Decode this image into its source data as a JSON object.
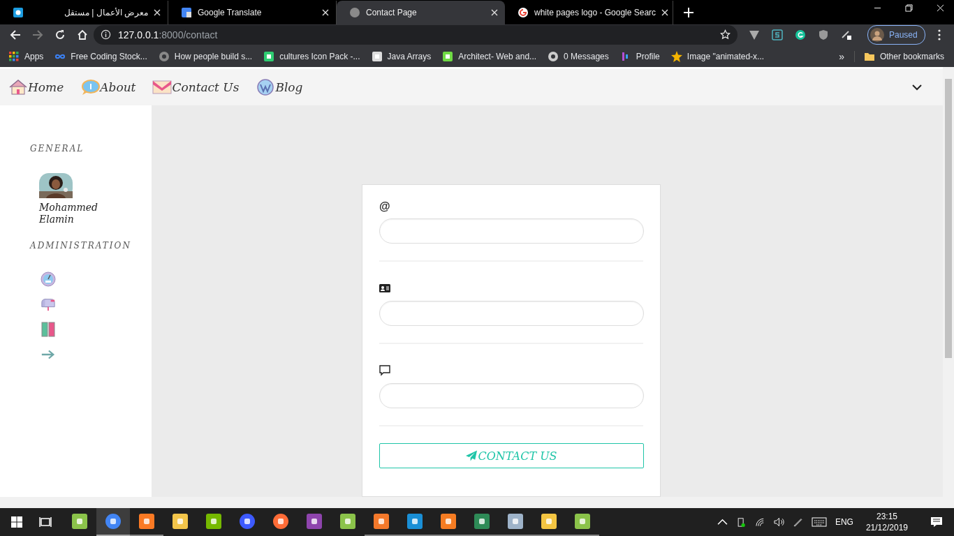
{
  "browser": {
    "tabs": [
      {
        "title": "معرض الأعمال | مستقل",
        "selected": false
      },
      {
        "title": "Google Translate",
        "selected": false
      },
      {
        "title": "Contact Page",
        "selected": true
      },
      {
        "title": "white pages logo - Google Searc",
        "selected": false
      }
    ],
    "address": {
      "host": "127.0.0.1",
      "path": ":8000/contact"
    },
    "profile": {
      "label": "Paused"
    },
    "bookmarks": [
      {
        "label": "Apps"
      },
      {
        "label": "Free Coding Stock..."
      },
      {
        "label": "How people build s..."
      },
      {
        "label": "cultures Icon Pack -..."
      },
      {
        "label": "Java Arrays"
      },
      {
        "label": "Architect- Web and..."
      },
      {
        "label": "0 Messages"
      },
      {
        "label": "Profile"
      },
      {
        "label": "Image \"animated-x..."
      }
    ],
    "overflow": "»",
    "other_bookmarks": "Other bookmarks"
  },
  "navbar": {
    "links": [
      {
        "label": "Home"
      },
      {
        "label": "About"
      },
      {
        "label": "Contact Us"
      },
      {
        "label": "Blog"
      }
    ]
  },
  "sidebar": {
    "sections": [
      {
        "heading": "GENERAL",
        "items": [
          {
            "kind": "user",
            "name": "Mohammed Elamin"
          }
        ]
      },
      {
        "heading": "ADMINISTRATION",
        "items": [
          {
            "kind": "icon"
          },
          {
            "kind": "icon"
          },
          {
            "kind": "icon"
          },
          {
            "kind": "icon"
          }
        ]
      }
    ]
  },
  "form": {
    "fields": [
      {
        "kind": "text",
        "label": "@"
      },
      {
        "kind": "icon"
      },
      {
        "kind": "icon"
      }
    ],
    "submit": "CONTACT US"
  },
  "taskbar": {
    "apps": [
      {
        "selected": false,
        "running": false
      },
      {
        "selected": true,
        "running": true
      },
      {
        "selected": false,
        "running": true
      },
      {
        "selected": false,
        "running": false
      },
      {
        "selected": false,
        "running": false
      },
      {
        "selected": false,
        "running": false
      },
      {
        "selected": false,
        "running": false
      },
      {
        "selected": false,
        "running": false
      },
      {
        "selected": false,
        "running": false
      },
      {
        "selected": false,
        "running": true
      },
      {
        "selected": false,
        "running": true
      },
      {
        "selected": false,
        "running": true
      },
      {
        "selected": false,
        "running": true
      },
      {
        "selected": false,
        "running": true
      },
      {
        "selected": false,
        "running": true
      },
      {
        "selected": false,
        "running": true
      }
    ],
    "language": "ENG",
    "time": "23:15",
    "date": "21/12/2019"
  }
}
